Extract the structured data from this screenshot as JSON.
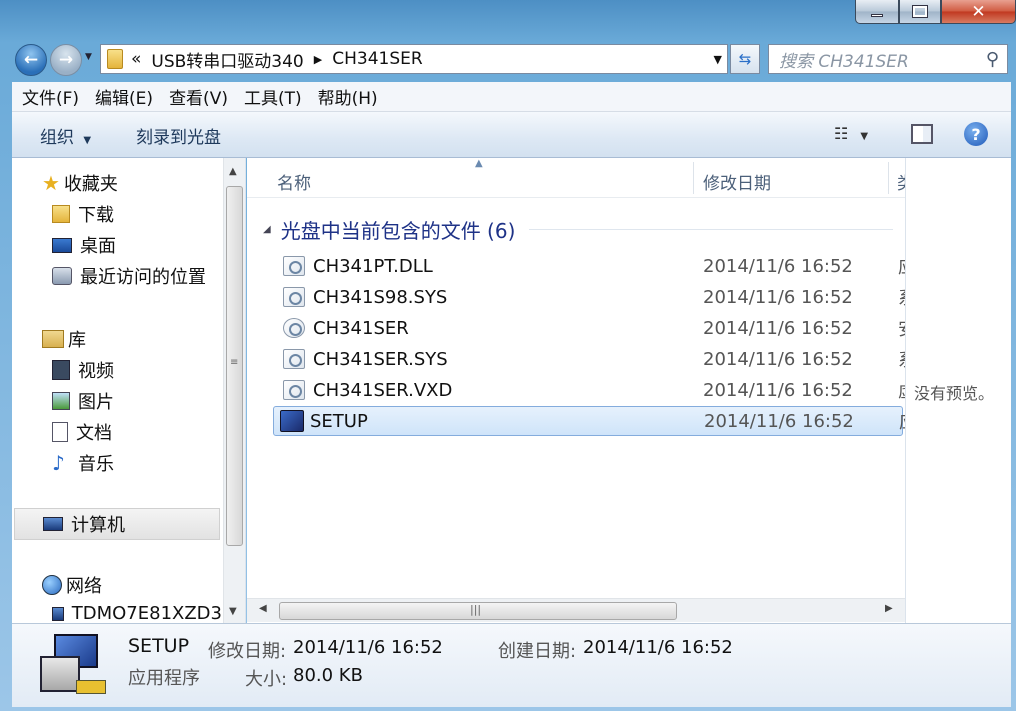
{
  "address": {
    "overflow": "«",
    "crumbs": [
      "USB转串口驱动340",
      "CH341SER"
    ]
  },
  "search": {
    "placeholder": "搜索 CH341SER"
  },
  "menu": [
    "文件(F)",
    "编辑(E)",
    "查看(V)",
    "工具(T)",
    "帮助(H)"
  ],
  "toolbar": {
    "organize": "组织",
    "burn": "刻录到光盘"
  },
  "nav": {
    "favorites": {
      "label": "收藏夹",
      "items": [
        "下载",
        "桌面",
        "最近访问的位置"
      ]
    },
    "libraries": {
      "label": "库",
      "items": [
        "视频",
        "图片",
        "文档",
        "音乐"
      ]
    },
    "computer": "计算机",
    "network": {
      "label": "网络",
      "items": [
        "TDMO7E81XZD3"
      ]
    }
  },
  "columns": {
    "name": "名称",
    "date": "修改日期",
    "type": "类"
  },
  "group": {
    "title": "光盘中当前包含的文件 (6)"
  },
  "files": [
    {
      "name": "CH341PT.DLL",
      "date": "2014/11/6 16:52",
      "type": "应"
    },
    {
      "name": "CH341S98.SYS",
      "date": "2014/11/6 16:52",
      "type": "系"
    },
    {
      "name": "CH341SER",
      "date": "2014/11/6 16:52",
      "type": "安"
    },
    {
      "name": "CH341SER.SYS",
      "date": "2014/11/6 16:52",
      "type": "系"
    },
    {
      "name": "CH341SER.VXD",
      "date": "2014/11/6 16:52",
      "type": "虚"
    },
    {
      "name": "SETUP",
      "date": "2014/11/6 16:52",
      "type": "应"
    }
  ],
  "preview": {
    "text": "没有预览。"
  },
  "details": {
    "name": "SETUP",
    "kind": "应用程序",
    "modified_label": "修改日期:",
    "modified": "2014/11/6 16:52",
    "created_label": "创建日期:",
    "created": "2014/11/6 16:52",
    "size_label": "大小:",
    "size": "80.0 KB"
  },
  "colors": {
    "accent": "#1e395b",
    "selection": "#cfe4fa",
    "group_title": "#1e3287"
  }
}
